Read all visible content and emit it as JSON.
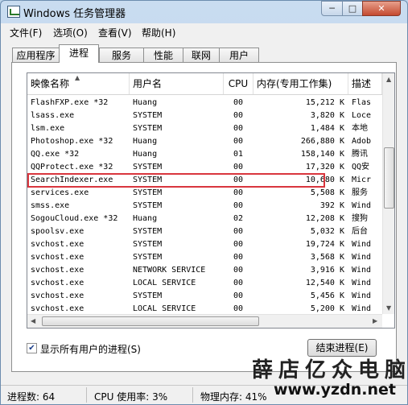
{
  "window": {
    "title": "Windows 任务管理器",
    "btn_min": "─",
    "btn_max": "□",
    "btn_close": "✕"
  },
  "menu": [
    "文件(F)",
    "选项(O)",
    "查看(V)",
    "帮助(H)"
  ],
  "tabs": [
    "应用程序",
    "进程",
    "服务",
    "性能",
    "联网",
    "用户"
  ],
  "active_tab": "进程",
  "columns": [
    "映像名称",
    "用户名",
    "CPU",
    "内存(专用工作集)",
    "描述"
  ],
  "rows": [
    {
      "name": "FlashFXP.exe *32",
      "user": "Huang",
      "cpu": "00",
      "mem": "15,212 K",
      "desc": "Flas"
    },
    {
      "name": "lsass.exe",
      "user": "SYSTEM",
      "cpu": "00",
      "mem": "3,820 K",
      "desc": "Loce"
    },
    {
      "name": "lsm.exe",
      "user": "SYSTEM",
      "cpu": "00",
      "mem": "1,484 K",
      "desc": "本地"
    },
    {
      "name": "Photoshop.exe *32",
      "user": "Huang",
      "cpu": "00",
      "mem": "266,880 K",
      "desc": "Adob"
    },
    {
      "name": "QQ.exe *32",
      "user": "Huang",
      "cpu": "01",
      "mem": "158,140 K",
      "desc": "腾讯"
    },
    {
      "name": "QQProtect.exe *32",
      "user": "SYSTEM",
      "cpu": "00",
      "mem": "17,320 K",
      "desc": "QQ安"
    },
    {
      "name": "SearchIndexer.exe",
      "user": "SYSTEM",
      "cpu": "00",
      "mem": "10,680 K",
      "desc": "Micr"
    },
    {
      "name": "services.exe",
      "user": "SYSTEM",
      "cpu": "00",
      "mem": "5,508 K",
      "desc": "服务"
    },
    {
      "name": "smss.exe",
      "user": "SYSTEM",
      "cpu": "00",
      "mem": "392 K",
      "desc": "Wind"
    },
    {
      "name": "SogouCloud.exe *32",
      "user": "Huang",
      "cpu": "02",
      "mem": "12,208 K",
      "desc": "搜狗"
    },
    {
      "name": "spoolsv.exe",
      "user": "SYSTEM",
      "cpu": "00",
      "mem": "5,032 K",
      "desc": "后台"
    },
    {
      "name": "svchost.exe",
      "user": "SYSTEM",
      "cpu": "00",
      "mem": "19,724 K",
      "desc": "Wind"
    },
    {
      "name": "svchost.exe",
      "user": "SYSTEM",
      "cpu": "00",
      "mem": "3,568 K",
      "desc": "Wind"
    },
    {
      "name": "svchost.exe",
      "user": "NETWORK SERVICE",
      "cpu": "00",
      "mem": "3,916 K",
      "desc": "Wind"
    },
    {
      "name": "svchost.exe",
      "user": "LOCAL SERVICE",
      "cpu": "00",
      "mem": "12,540 K",
      "desc": "Wind"
    },
    {
      "name": "svchost.exe",
      "user": "SYSTEM",
      "cpu": "00",
      "mem": "5,456 K",
      "desc": "Wind"
    },
    {
      "name": "svchost.exe",
      "user": "LOCAL SERVICE",
      "cpu": "00",
      "mem": "5,200 K",
      "desc": "Wind"
    },
    {
      "name": "svchost.exe",
      "user": "NETWORK SERVICE",
      "cpu": "00",
      "mem": "18,828 K",
      "desc": "Wind"
    }
  ],
  "highlighted_process": "SearchIndexer.exe",
  "show_all_users": {
    "checked": true,
    "label": "显示所有用户的进程(S)"
  },
  "end_process_label": "结束进程(E)",
  "status": {
    "processes": "进程数: 64",
    "cpu": "CPU 使用率: 3%",
    "memory": "物理内存: 41%"
  },
  "watermark": {
    "text": "薛店亿众电脑",
    "url": "www.yzdn.net"
  },
  "colors": {
    "highlight_border": "#d9363e",
    "title_bg": "#c9dcf0",
    "panel_bg": "#f0f0f0"
  }
}
